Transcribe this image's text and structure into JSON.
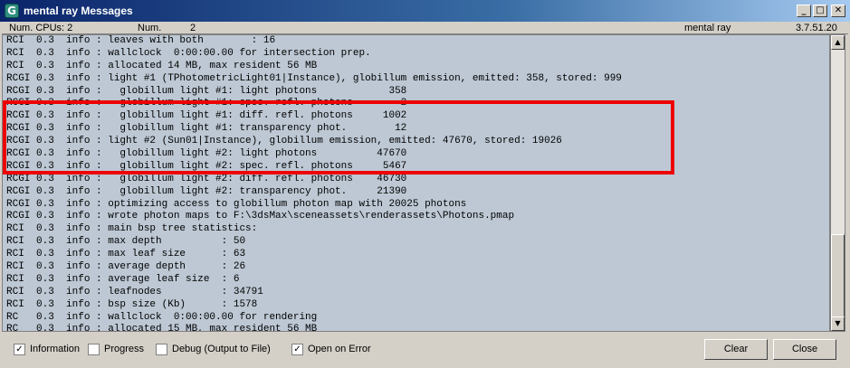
{
  "window": {
    "title": "mental ray Messages",
    "minimize_glyph": "_",
    "maximize_glyph": "□",
    "close_glyph": "✕"
  },
  "status": {
    "cpus_label": "Num. CPUs: 2",
    "num_label": "Num.",
    "num_value": "2",
    "renderer": "mental ray",
    "version": "3.7.51.20"
  },
  "log": {
    "lines": [
      "RCI  0.3  info : leaves with both        : 16",
      "RCI  0.3  info : wallclock  0:00:00.00 for intersection prep.",
      "RCI  0.3  info : allocated 14 MB, max resident 56 MB",
      "RCGI 0.3  info : light #1 (TPhotometricLight01|Instance), globillum emission, emitted: 358, stored: 999",
      "RCGI 0.3  info :   globillum light #1: light photons            358",
      "RCGI 0.3  info :   globillum light #1: spec. refl. photons        2",
      "RCGI 0.3  info :   globillum light #1: diff. refl. photons     1002",
      "RCGI 0.3  info :   globillum light #1: transparency phot.        12",
      "RCGI 0.3  info : light #2 (Sun01|Instance), globillum emission, emitted: 47670, stored: 19026",
      "RCGI 0.3  info :   globillum light #2: light photons          47670",
      "RCGI 0.3  info :   globillum light #2: spec. refl. photons     5467",
      "RCGI 0.3  info :   globillum light #2: diff. refl. photons    46730",
      "RCGI 0.3  info :   globillum light #2: transparency phot.     21390",
      "RCGI 0.3  info : optimizing access to globillum photon map with 20025 photons",
      "RCGI 0.3  info : wrote photon maps to F:\\3dsMax\\sceneassets\\renderassets\\Photons.pmap",
      "RCI  0.3  info : main bsp tree statistics:",
      "RCI  0.3  info : max depth          : 50",
      "RCI  0.3  info : max leaf size      : 63",
      "RCI  0.3  info : average depth      : 26",
      "RCI  0.3  info : average leaf size  : 6",
      "RCI  0.3  info : leafnodes          : 34791",
      "RCI  0.3  info : bsp size (Kb)      : 1578",
      "RC   0.3  info : wallclock  0:00:00.00 for rendering",
      "RC   0.3  info : allocated 15 MB, max resident 56 MB"
    ]
  },
  "scrollbar": {
    "up_glyph": "▲",
    "down_glyph": "▼"
  },
  "options": {
    "information": {
      "label": "Information",
      "checked": true
    },
    "progress": {
      "label": "Progress",
      "checked": false
    },
    "debug": {
      "label": "Debug (Output to File)",
      "checked": false
    },
    "open_on_error": {
      "label": "Open on Error",
      "checked": true
    },
    "check_glyph": "✓"
  },
  "buttons": {
    "clear": "Clear",
    "close": "Close"
  },
  "colors": {
    "highlight": "#ee0000",
    "log_background": "#bdc8d4",
    "title_bar": "#0a246a"
  }
}
